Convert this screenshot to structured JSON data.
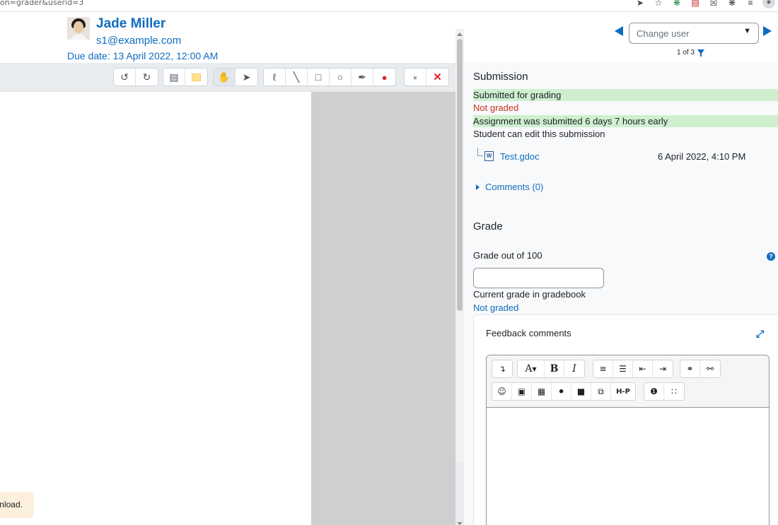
{
  "browser": {
    "url_fragment": "on=grader&userid=3",
    "icons": [
      "send-icon",
      "star-icon",
      "extension-green-icon",
      "clipboard-icon",
      "x-extension-icon",
      "puzzle-icon",
      "reading-list-icon",
      "profile-icon"
    ]
  },
  "user": {
    "name": "Jade Miller",
    "email": "s1@example.com",
    "due_date": "Due date: 13 April 2022, 12:00 AM"
  },
  "nav": {
    "change_user_placeholder": "Change user",
    "pager": "1 of 3"
  },
  "editor_toolbar": {
    "groups": [
      [
        "rotate-left-icon",
        "rotate-right-icon"
      ],
      [
        "comment-icon",
        "sticky-note-icon"
      ],
      [
        "hand-pan-icon",
        "select-pointer-icon"
      ],
      [
        "pen-icon",
        "line-icon",
        "rectangle-icon",
        "oval-icon",
        "highlighter-icon",
        "color-drop-icon"
      ],
      [
        "stamp-icon",
        "delete-icon"
      ]
    ]
  },
  "toast": {
    "text": "nload."
  },
  "submission": {
    "title": "Submission",
    "status_submitted": "Submitted for grading",
    "status_grading": "Not graded",
    "status_early": "Assignment was submitted 6 days 7 hours early",
    "status_edit": "Student can edit this submission",
    "file_name": "Test.gdoc",
    "file_icon_letter": "W",
    "file_date": "6 April 2022, 4:10 PM",
    "comments_label": "Comments (0)"
  },
  "grade": {
    "title": "Grade",
    "grade_label": "Grade out of 100",
    "grade_value": "",
    "gradebook_label": "Current grade in gradebook",
    "gradebook_value": "Not graded"
  },
  "feedback": {
    "title": "Feedback comments",
    "toolbar_row1": [
      "collapse-icon",
      "font-style-icon",
      "bold-icon",
      "italic-icon",
      "unordered-list-icon",
      "ordered-list-icon",
      "outdent-icon",
      "indent-icon",
      "link-icon",
      "unlink-icon"
    ],
    "toolbar_row2": [
      "emoji-icon",
      "image-icon",
      "media-icon",
      "record-audio-icon",
      "record-video-icon",
      "manage-files-icon",
      "h5p-icon",
      "accessibility-checker-icon",
      "screenreader-helper-icon"
    ],
    "h5p_label": "H-P",
    "bold_glyph": "B",
    "italic_glyph": "I",
    "font_glyph": "A"
  },
  "colors": {
    "link": "#0f6cbf",
    "success_bg": "#cfefcf",
    "danger": "#ca3120",
    "toast_bg": "#fcefdc"
  }
}
